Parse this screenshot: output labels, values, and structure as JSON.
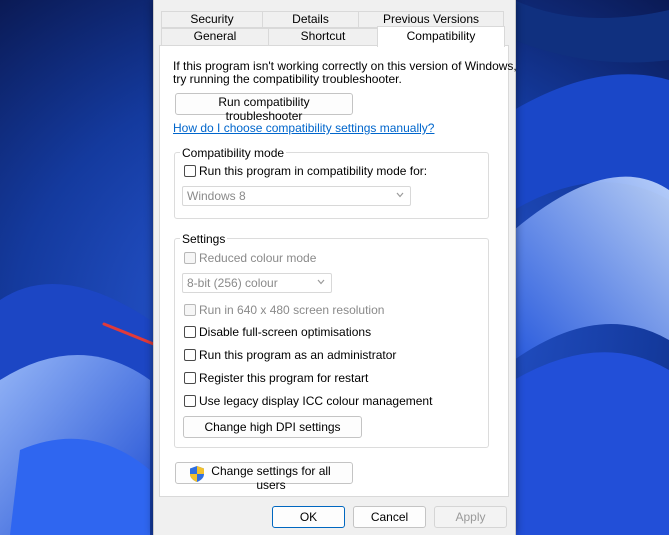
{
  "tabs": {
    "row1": [
      "Security",
      "Details",
      "Previous Versions"
    ],
    "row2": [
      "General",
      "Shortcut",
      "Compatibility"
    ]
  },
  "intro_line1": "If this program isn't working correctly on this version of Windows,",
  "intro_line2": "try running the compatibility troubleshooter.",
  "troubleshooter_button": "Run compatibility troubleshooter",
  "help_link": "How do I choose compatibility settings manually?",
  "compat_mode": {
    "legend": "Compatibility mode",
    "checkbox_label": "Run this program in compatibility mode for:",
    "selected_os": "Windows 8"
  },
  "settings": {
    "legend": "Settings",
    "reduced_colour": "Reduced colour mode",
    "colour_value": "8-bit (256) colour",
    "run_640": "Run in 640 x 480 screen resolution",
    "disable_fullscreen": "Disable full-screen optimisations",
    "run_admin": "Run this program as an administrator",
    "register_restart": "Register this program for restart",
    "legacy_icc": "Use legacy display ICC colour management",
    "dpi_button": "Change high DPI settings"
  },
  "all_users_button": "Change settings for all users",
  "footer": {
    "ok": "OK",
    "cancel": "Cancel",
    "apply": "Apply"
  },
  "colors": {
    "link": "#0066cc",
    "arrow": "#e03a3a",
    "ok_border": "#0067c0"
  }
}
